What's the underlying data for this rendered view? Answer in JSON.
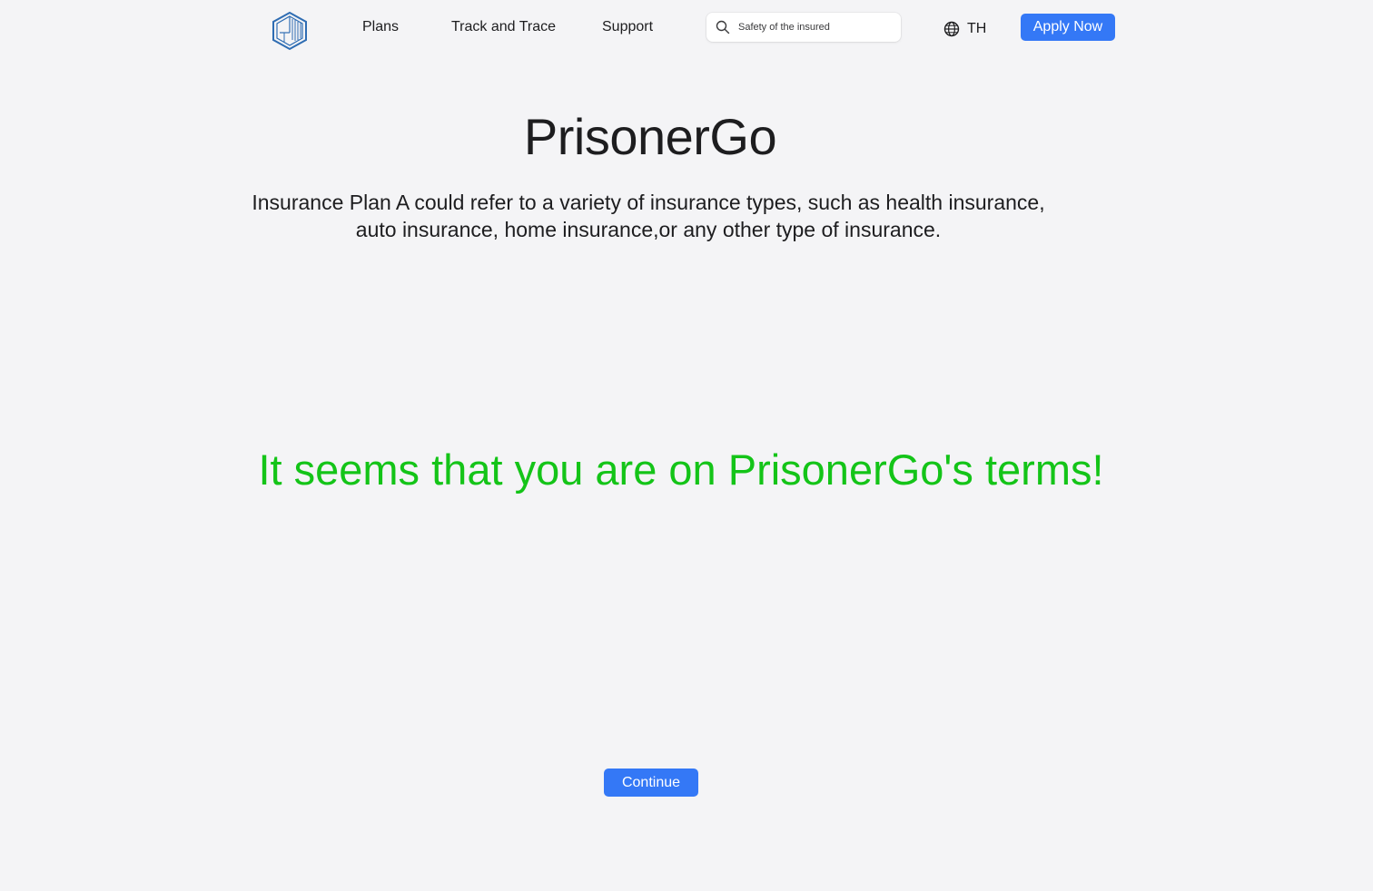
{
  "nav": {
    "logo_icon": "hexagon-shield-logo-icon",
    "links": [
      "Plans",
      "Track and Trace",
      "Support"
    ],
    "search": {
      "icon": "search-icon",
      "placeholder": "Safety of the insured",
      "value": ""
    },
    "language": {
      "icon": "globe-icon",
      "label": "TH"
    },
    "apply_label": "Apply Now"
  },
  "hero": {
    "title": "PrisonerGo",
    "description": "Insurance Plan A could refer to a variety of insurance types, such as health insurance, auto insurance, home insurance,or any other type of insurance."
  },
  "notice": {
    "text": "It seems that you are on PrisonerGo's terms!",
    "color": "#14c418"
  },
  "continue_label": "Continue",
  "colors": {
    "accent": "#3478f6",
    "background": "#f4f4f6",
    "logo": "#2f6db3"
  }
}
